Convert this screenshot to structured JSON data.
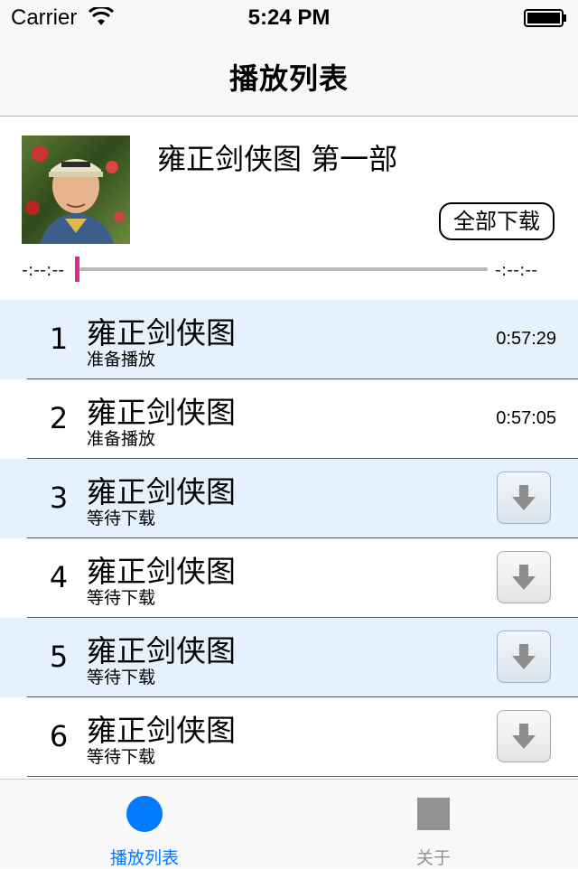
{
  "status_bar": {
    "carrier": "Carrier",
    "time": "5:24 PM"
  },
  "nav": {
    "title": "播放列表"
  },
  "album": {
    "title": "雍正剑侠图 第一部",
    "download_all_label": "全部下载",
    "time_elapsed": "-:--:--",
    "time_remaining": "-:--:--",
    "progress": 0
  },
  "tracks": [
    {
      "number": "1",
      "title": "雍正剑侠图",
      "status": "准备播放",
      "duration": "0:57:29"
    },
    {
      "number": "2",
      "title": "雍正剑侠图",
      "status": "准备播放",
      "duration": "0:57:05"
    },
    {
      "number": "3",
      "title": "雍正剑侠图",
      "status": "等待下载",
      "action_icon": "download-arrow-icon"
    },
    {
      "number": "4",
      "title": "雍正剑侠图",
      "status": "等待下载",
      "action_icon": "download-arrow-icon"
    },
    {
      "number": "5",
      "title": "雍正剑侠图",
      "status": "等待下载",
      "action_icon": "download-arrow-icon"
    },
    {
      "number": "6",
      "title": "雍正剑侠图",
      "status": "等待下载",
      "action_icon": "download-arrow-icon"
    }
  ],
  "tab_bar": {
    "items": [
      {
        "label": "播放列表",
        "icon": "circle-icon",
        "active": true
      },
      {
        "label": "关于",
        "icon": "square-icon",
        "active": false
      }
    ]
  },
  "colors": {
    "accent": "#007aff",
    "progress_handle": "#e6278e",
    "row_alt": "#e5f1fc",
    "separator": "#0a7a66"
  }
}
